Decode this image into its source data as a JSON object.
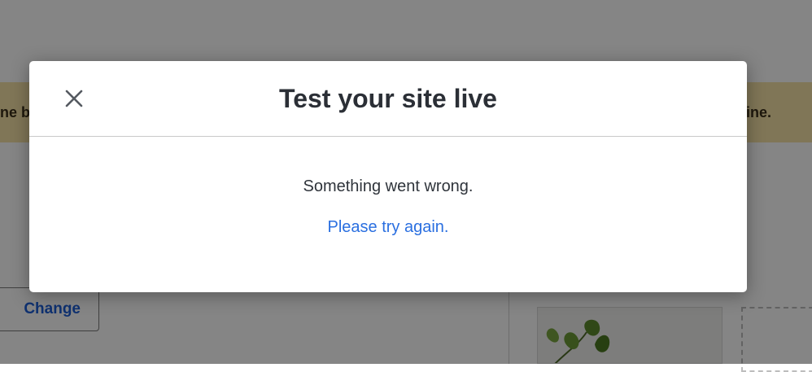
{
  "background": {
    "banner_left_text": "ne b",
    "banner_right_text": "ine.",
    "change_button_label": "Change"
  },
  "modal": {
    "title": "Test your site live",
    "close_icon": "close-icon",
    "message": "Something went wrong.",
    "retry_link": "Please try again."
  },
  "colors": {
    "link": "#2a6fe0",
    "banner": "#f6e3a8",
    "title": "#2b2f36"
  }
}
